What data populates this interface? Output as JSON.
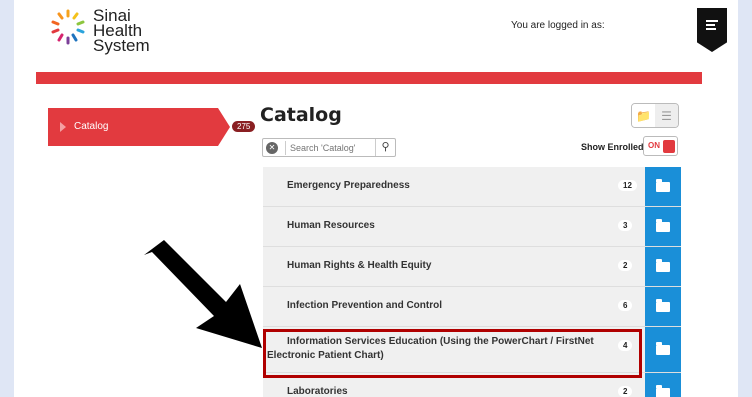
{
  "header": {
    "logo_line1": "Sinai",
    "logo_line2": "Health",
    "logo_line3": "System",
    "logged_in_text": "You are logged in as:"
  },
  "sidebar": {
    "items": [
      {
        "label": "Catalog",
        "count": "275"
      }
    ]
  },
  "main": {
    "title": "Catalog",
    "search_placeholder": "Search 'Catalog'",
    "show_enrolled_label": "Show Enrolled",
    "toggle_text": "ON",
    "rows": [
      {
        "name": "Emergency Preparedness",
        "count": "12"
      },
      {
        "name": "Human Resources",
        "count": "3"
      },
      {
        "name": "Human Rights & Health Equity",
        "count": "2"
      },
      {
        "name": "Infection Prevention and Control",
        "count": "6"
      },
      {
        "name": "Information Services Education (Using the PowerChart / FirstNet Electronic Patient Chart)",
        "count": "4"
      },
      {
        "name": "Laboratories",
        "count": "2"
      }
    ]
  },
  "colors": {
    "brand_red": "#e23a3f",
    "folder_blue": "#1a8fd8",
    "highlight_red": "#b00000"
  },
  "icons": [
    "menu-icon",
    "folder-view-icon",
    "list-view-icon",
    "clear-search-icon",
    "search-icon",
    "folder-icon",
    "pointer-arrow"
  ]
}
